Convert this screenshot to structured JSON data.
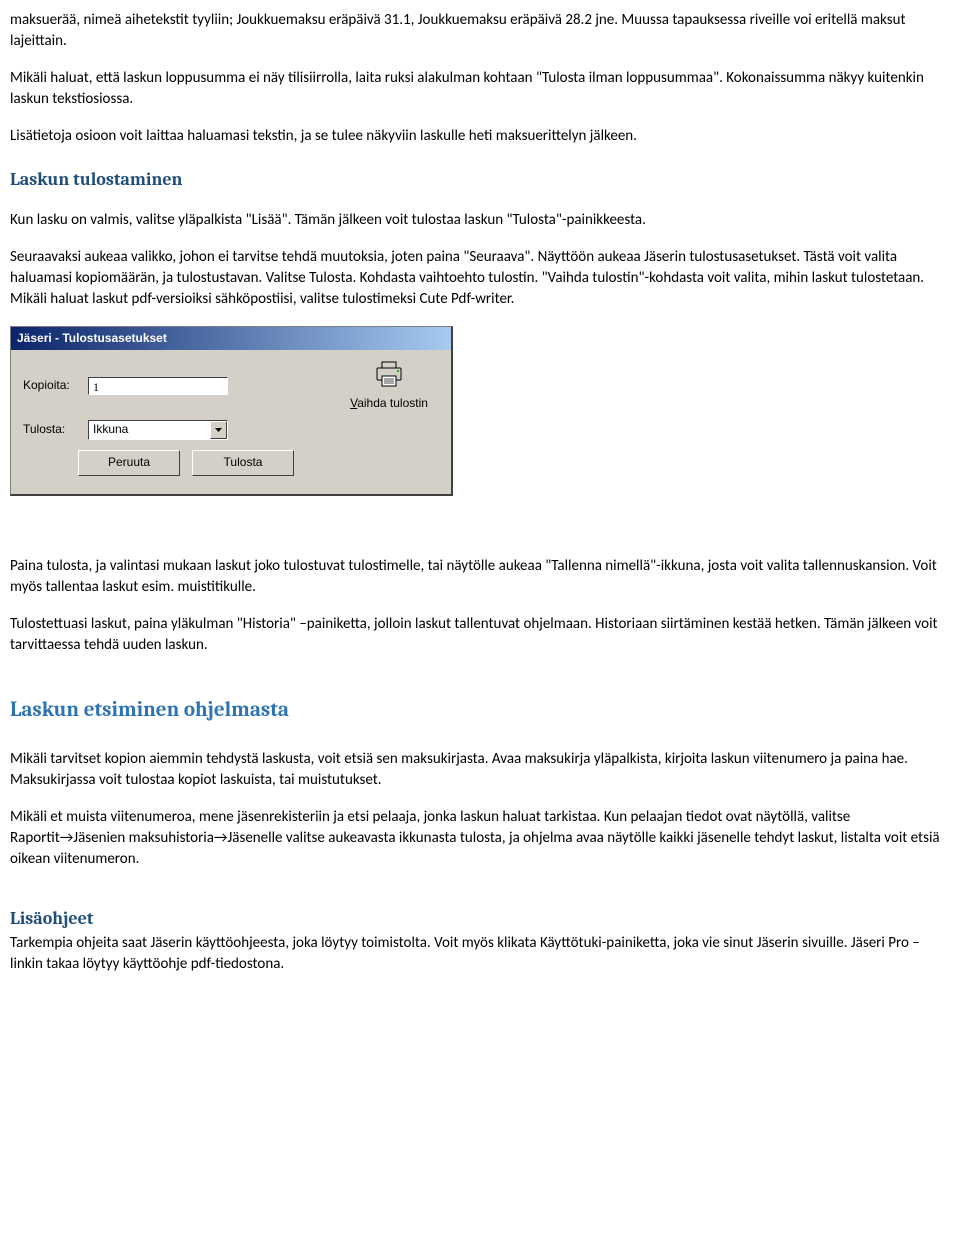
{
  "paragraphs": {
    "p1": "maksuerää, nimeä aihetekstit tyyliin; Joukkuemaksu eräpäivä 31.1, Joukkuemaksu eräpäivä 28.2 jne. Muussa tapauksessa riveille voi eritellä maksut lajeittain.",
    "p2": "Mikäli haluat, että laskun loppusumma ei näy tilisiirrolla, laita ruksi alakulman kohtaan \"Tulosta ilman loppusummaa\". Kokonaissumma näkyy kuitenkin laskun tekstiosiossa.",
    "p3": "Lisätietoja osioon voit laittaa haluamasi tekstin, ja se tulee näkyviin laskulle heti maksuerittelyn jälkeen.",
    "p4": "Kun lasku on valmis, valitse yläpalkista \"Lisää\". Tämän jälkeen voit tulostaa laskun \"Tulosta\"-painikkeesta.",
    "p5": "Seuraavaksi aukeaa valikko, johon ei tarvitse tehdä muutoksia, joten paina \"Seuraava\". Näyttöön aukeaa Jäserin tulostusasetukset. Tästä voit valita haluamasi kopiomäärän, ja tulostustavan. Valitse Tulosta. Kohdasta vaihtoehto tulostin. \"Vaihda tulostin\"-kohdasta voit valita, mihin laskut tulostetaan. Mikäli haluat laskut pdf-versioiksi sähköpostiisi, valitse  tulostimeksi Cute Pdf-writer.",
    "p6": "Paina tulosta, ja valintasi mukaan laskut joko tulostuvat tulostimelle, tai näytölle aukeaa \"Tallenna nimellä\"-ikkuna, josta voit valita tallennuskansion. Voit myös tallentaa laskut esim. muistitikulle.",
    "p7": "Tulostettuasi laskut, paina yläkulman \"Historia\" –painiketta, jolloin laskut tallentuvat ohjelmaan. Historiaan siirtäminen kestää hetken. Tämän jälkeen voit tarvittaessa tehdä uuden laskun.",
    "p8": "Mikäli tarvitset kopion aiemmin tehdystä laskusta, voit etsiä sen maksukirjasta. Avaa maksukirja yläpalkista, kirjoita laskun viitenumero ja paina hae. Maksukirjassa voit tulostaa kopiot laskuista, tai muistutukset.",
    "p9": "Mikäli et muista viitenumeroa, mene jäsenrekisteriin ja etsi pelaaja, jonka laskun haluat tarkistaa. Kun pelaajan tiedot ovat näytöllä, valitse Raportit→Jäsenien maksuhistoria→Jäsenelle valitse aukeavasta ikkunasta tulosta, ja ohjelma avaa näytölle kaikki jäsenelle tehdyt laskut, listalta voit etsiä oikean viitenumeron.",
    "p10": "Tarkempia ohjeita saat Jäserin käyttöohjeesta, joka löytyy toimistolta. Voit myös klikata Käyttötuki-painiketta, joka vie sinut Jäserin sivuille. Jäseri Pro – linkin takaa löytyy käyttöohje pdf-tiedostona."
  },
  "headings": {
    "h1": "Laskun tulostaminen",
    "h2": "Laskun etsiminen ohjelmasta",
    "h3": "Lisäohjeet"
  },
  "dialog": {
    "title": "Jäseri - Tulostusasetukset",
    "label_copies": "Kopioita:",
    "value_copies": "1",
    "label_tulosta": "Tulosta:",
    "value_select": "Ikkuna",
    "change_printer_pre": "V",
    "change_printer_post": "aihda tulostin",
    "btn_cancel": "Peruuta",
    "btn_print": "Tulosta"
  }
}
